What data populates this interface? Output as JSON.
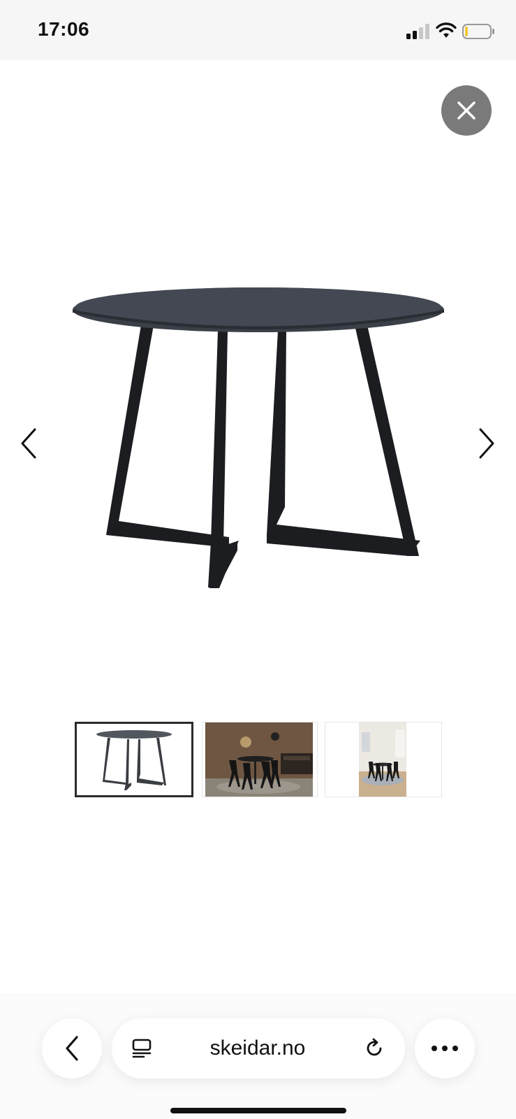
{
  "status": {
    "time": "17:06"
  },
  "browser": {
    "url": "skeidar.no"
  },
  "gallery": {
    "thumbnails": [
      "product-front",
      "dining-room-scene",
      "bright-room-scene"
    ],
    "selected_index": 0
  },
  "colors": {
    "tabletop": "#3b4048",
    "legs": "#1c1d20",
    "close_button": "#7a7a7a"
  }
}
